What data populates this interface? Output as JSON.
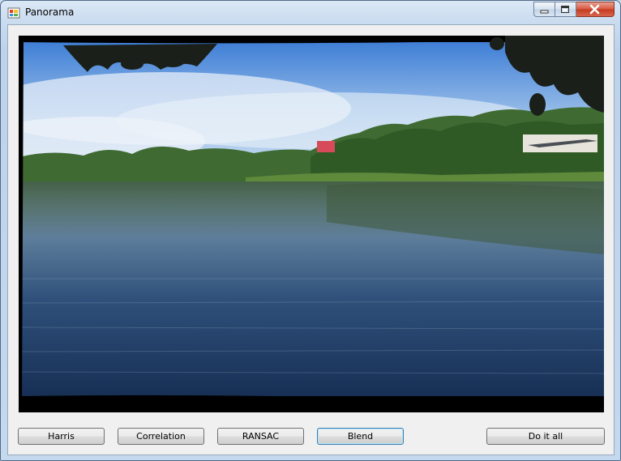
{
  "window": {
    "title": "Panorama",
    "icon": "app-window-icon"
  },
  "controls": {
    "minimize": "minimize-icon",
    "maximize": "maximize-icon",
    "close": "close-icon"
  },
  "image": {
    "description_icon": "panorama-image"
  },
  "buttons": {
    "harris": "Harris",
    "correlation": "Correlation",
    "ransac": "RANSAC",
    "blend": "Blend",
    "do_it_all": "Do it all"
  },
  "colors": {
    "close_red": "#c43a1f",
    "default_button_border": "#3c7fb1",
    "window_frame": "#c4d8ee"
  }
}
